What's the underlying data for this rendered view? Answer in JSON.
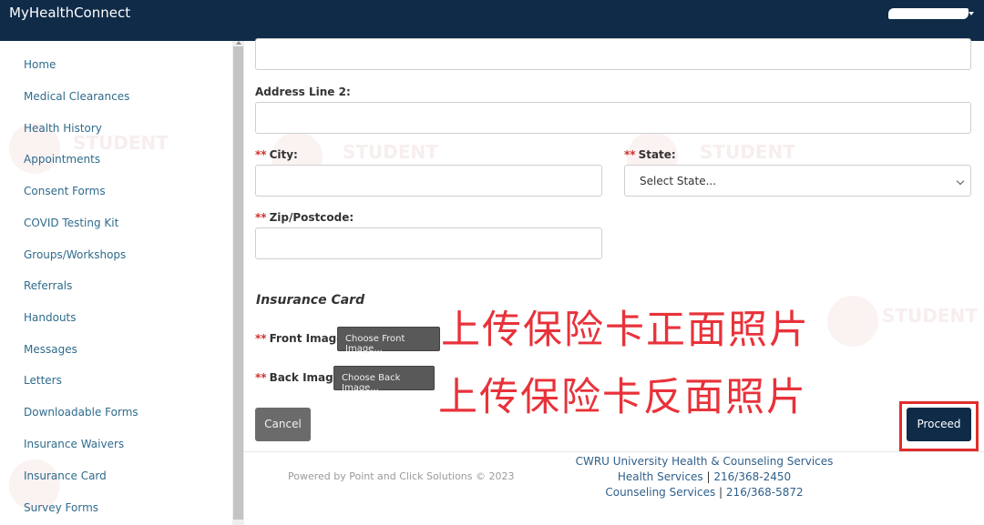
{
  "app": {
    "title": "MyHealthConnect"
  },
  "sidebar": {
    "items": [
      {
        "label": "Home"
      },
      {
        "label": "Medical Clearances"
      },
      {
        "label": "Health History"
      },
      {
        "label": "Appointments"
      },
      {
        "label": "Consent Forms"
      },
      {
        "label": "COVID Testing Kit"
      },
      {
        "label": "Groups/Workshops"
      },
      {
        "label": "Referrals"
      },
      {
        "label": "Handouts"
      },
      {
        "label": "Messages"
      },
      {
        "label": "Letters"
      },
      {
        "label": "Downloadable Forms"
      },
      {
        "label": "Insurance Waivers"
      },
      {
        "label": "Insurance Card"
      },
      {
        "label": "Survey Forms"
      }
    ]
  },
  "form": {
    "required_marker": "**",
    "address_line_2": {
      "label": "Address Line 2:",
      "value": ""
    },
    "city": {
      "label": "City:",
      "value": ""
    },
    "state": {
      "label": "State:",
      "selected": "Select State..."
    },
    "zip": {
      "label": "Zip/Postcode:",
      "value": ""
    },
    "insurance_card": {
      "title": "Insurance Card",
      "front": {
        "label": "Front Image:",
        "button": "Choose Front Image..."
      },
      "back": {
        "label": "Back Image:",
        "button": "Choose Back Image..."
      }
    },
    "cancel_label": "Cancel",
    "proceed_label": "Proceed"
  },
  "annotations": {
    "front": "上传保险卡正面照片",
    "back": "上传保险卡反面照片"
  },
  "footer": {
    "powered_by": "Powered by Point and Click Solutions © 2023",
    "org": "CWRU University Health & Counseling Services",
    "health_label": "Health Services",
    "health_phone": "216/368-2450",
    "counseling_label": "Counseling Services",
    "counseling_phone": "216/368-5872",
    "separator": "|"
  },
  "colors": {
    "header_bg": "#0f2b48",
    "link": "#2f6b8c",
    "required": "#d0302c",
    "annotation": "#e8323a",
    "primary_button": "#0f2b48"
  }
}
